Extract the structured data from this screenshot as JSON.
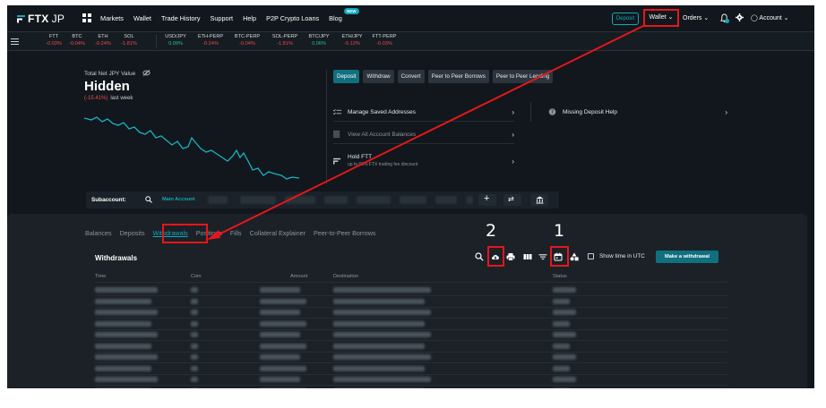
{
  "nav": {
    "logo_text": "FTX",
    "logo_region": "JP",
    "links": [
      "Markets",
      "Wallet",
      "Trade History",
      "Support",
      "Help",
      "P2P Crypto Loans",
      "Blog"
    ],
    "blog_badge": "NEW",
    "deposit_label": "Deposit",
    "wallet_label": "Wallet",
    "orders_label": "Orders",
    "account_label": "Account",
    "icons": [
      "apps-icon",
      "bell-icon",
      "gear-icon",
      "user-icon",
      "chevron-down-icon"
    ]
  },
  "ticker": [
    {
      "symbol": "FTT",
      "change": "-0.03%",
      "dir": "neg"
    },
    {
      "symbol": "BTC",
      "change": "-0.04%",
      "dir": "neg"
    },
    {
      "symbol": "ETH",
      "change": "-0.24%",
      "dir": "neg"
    },
    {
      "symbol": "SOL",
      "change": "-1.81%",
      "dir": "neg"
    },
    {
      "symbol": "USD/JPY",
      "change": "0.09%",
      "dir": "pos"
    },
    {
      "symbol": "ETH-PERP",
      "change": "-0.24%",
      "dir": "neg"
    },
    {
      "symbol": "BTC-PERP",
      "change": "-0.04%",
      "dir": "neg"
    },
    {
      "symbol": "SOL-PERP",
      "change": "-1.81%",
      "dir": "neg"
    },
    {
      "symbol": "BTC/JPY",
      "change": "0.06%",
      "dir": "pos"
    },
    {
      "symbol": "ETH/JPY",
      "change": "-0.12%",
      "dir": "neg"
    },
    {
      "symbol": "FTT-PERP",
      "change": "-0.03%",
      "dir": "neg"
    }
  ],
  "summary": {
    "label": "Total Net JPY Value",
    "value": "Hidden",
    "change": "(-15.41%)",
    "period": "last week"
  },
  "actions": [
    "Deposit",
    "Withdraw",
    "Convert",
    "Peer to Peer Borrows",
    "Peer to Peer Lending"
  ],
  "links_left": [
    {
      "label": "Manage Saved Addresses",
      "sub": "",
      "icon": "list-check-icon",
      "dim": false
    },
    {
      "label": "View All Account Balances",
      "sub": "",
      "icon": "ledger-icon",
      "dim": true
    },
    {
      "label": "Hold FTT",
      "sub": "up to 60% FTX trading fee discount",
      "icon": "ftt-icon",
      "dim": false
    }
  ],
  "links_right": [
    {
      "label": "Missing Deposit Help",
      "icon": "help-icon"
    }
  ],
  "subaccount": {
    "label": "Subaccount:",
    "main": "Main Account"
  },
  "tabs": [
    "Balances",
    "Deposits",
    "Withdrawals",
    "Positions",
    "Fills",
    "Collateral Explainer",
    "Peer-to-Peer Borrows"
  ],
  "active_tab": "Withdrawals",
  "withdrawals": {
    "title": "Withdrawals",
    "utc_label": "Show time in UTC",
    "make_button": "Make a withdrawal",
    "columns": [
      "Time",
      "Coin",
      "Amount",
      "Destination",
      "Status"
    ],
    "row_count": 11
  },
  "annotations": {
    "label_1": "1",
    "label_2": "2",
    "color": "#e8161b"
  }
}
